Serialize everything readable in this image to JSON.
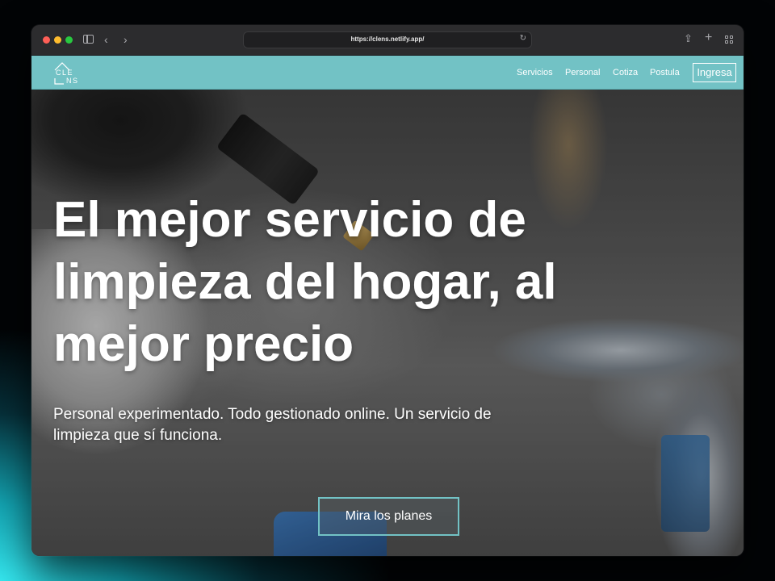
{
  "browser": {
    "url": "https://clens.netlify.app/",
    "icons": [
      "close-dot",
      "minimize-dot",
      "zoom-dot",
      "sidebar-icon",
      "back-icon",
      "forward-icon",
      "reload-icon",
      "share-icon",
      "new-tab-icon",
      "tab-overview-icon"
    ]
  },
  "navbar": {
    "logo": {
      "line1": "CLE",
      "line2": "NS"
    },
    "links": [
      "Servicios",
      "Personal",
      "Cotiza",
      "Postula"
    ],
    "login_label": "Ingresa"
  },
  "hero": {
    "headline": "El mejor servicio de limpieza del hogar, al mejor precio",
    "subtext": "Personal experimentado. Todo gestionado online. Un servicio de limpieza que sí funciona.",
    "cta_label": "Mira los planes"
  },
  "colors": {
    "accent": "#72c2c5",
    "traffic_red": "#ff5f57",
    "traffic_yellow": "#febc2e",
    "traffic_green": "#28c840"
  }
}
